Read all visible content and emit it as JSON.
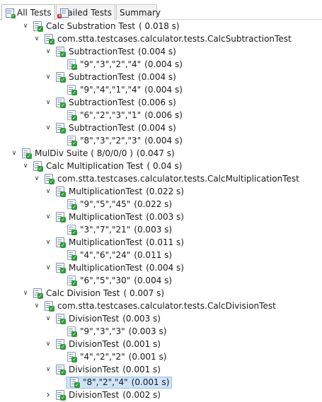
{
  "tabs": [
    {
      "label": "All Tests",
      "active": true
    },
    {
      "label": "Failed Tests",
      "active": false
    },
    {
      "label": "Summary",
      "active": false
    }
  ],
  "tree": [
    {
      "depth": 1,
      "arrow": "v",
      "label": "Calc Substration Test",
      "time": "( 0.018 s)"
    },
    {
      "depth": 2,
      "arrow": "v",
      "label": "com.stta.testcases.calculator.tests.CalcSubtractionTest",
      "time": ""
    },
    {
      "depth": 3,
      "arrow": "v",
      "label": "SubtractionTest",
      "time": "(0.004 s)"
    },
    {
      "depth": 4,
      "arrow": "",
      "label": "\"9\",\"3\",\"2\",\"4\"",
      "time": "(0.004 s)"
    },
    {
      "depth": 3,
      "arrow": "v",
      "label": "SubtractionTest",
      "time": "(0.004 s)"
    },
    {
      "depth": 4,
      "arrow": "",
      "label": "\"9\",\"4\",\"1\",\"4\"",
      "time": "(0.004 s)"
    },
    {
      "depth": 3,
      "arrow": "v",
      "label": "SubtractionTest",
      "time": "(0.006 s)"
    },
    {
      "depth": 4,
      "arrow": "",
      "label": "\"6\",\"2\",\"3\",\"1\"",
      "time": "(0.006 s)"
    },
    {
      "depth": 3,
      "arrow": "v",
      "label": "SubtractionTest",
      "time": "(0.004 s)"
    },
    {
      "depth": 4,
      "arrow": "",
      "label": "\"8\",\"3\",\"2\",\"3\"",
      "time": "(0.004 s)"
    },
    {
      "depth": 0,
      "arrow": "v",
      "label": "MulDiv Suite ( 8/0/0/0 )",
      "time": "(0.047 s)"
    },
    {
      "depth": 1,
      "arrow": "v",
      "label": "Calc Multiplication Test",
      "time": "( 0.04 s)"
    },
    {
      "depth": 2,
      "arrow": "v",
      "label": "com.stta.testcases.calculator.tests.CalcMultiplicationTest",
      "time": ""
    },
    {
      "depth": 3,
      "arrow": "v",
      "label": "MultiplicationTest",
      "time": "(0.022 s)"
    },
    {
      "depth": 4,
      "arrow": "",
      "label": "\"9\",\"5\",\"45\"",
      "time": "(0.022 s)"
    },
    {
      "depth": 3,
      "arrow": "v",
      "label": "MultiplicationTest",
      "time": "(0.003 s)"
    },
    {
      "depth": 4,
      "arrow": "",
      "label": "\"3\",\"7\",\"21\"",
      "time": "(0.003 s)"
    },
    {
      "depth": 3,
      "arrow": "v",
      "label": "MultiplicationTest",
      "time": "(0.011 s)"
    },
    {
      "depth": 4,
      "arrow": "",
      "label": "\"4\",\"6\",\"24\"",
      "time": "(0.011 s)"
    },
    {
      "depth": 3,
      "arrow": "v",
      "label": "MultiplicationTest",
      "time": "(0.004 s)"
    },
    {
      "depth": 4,
      "arrow": "",
      "label": "\"6\",\"5\",\"30\"",
      "time": "(0.004 s)"
    },
    {
      "depth": 1,
      "arrow": "v",
      "label": "Calc Division Test",
      "time": "( 0.007 s)"
    },
    {
      "depth": 2,
      "arrow": "v",
      "label": "com.stta.testcases.calculator.tests.CalcDivisionTest",
      "time": ""
    },
    {
      "depth": 3,
      "arrow": "v",
      "label": "DivisionTest",
      "time": "(0.003 s)"
    },
    {
      "depth": 4,
      "arrow": "",
      "label": "\"9\",\"3\",\"3\"",
      "time": "(0.003 s)"
    },
    {
      "depth": 3,
      "arrow": "v",
      "label": "DivisionTest",
      "time": "(0.001 s)"
    },
    {
      "depth": 4,
      "arrow": "",
      "label": "\"4\",\"2\",\"2\"",
      "time": "(0.001 s)"
    },
    {
      "depth": 3,
      "arrow": "v",
      "label": "DivisionTest",
      "time": "(0.001 s)"
    },
    {
      "depth": 4,
      "arrow": "",
      "label": "\"8\",\"2\",\"4\"",
      "time": "(0.001 s)",
      "selected": true
    },
    {
      "depth": 3,
      "arrow": ">",
      "label": "DivisionTest",
      "time": "(0.002 s)"
    }
  ],
  "colors": {
    "pass": "#2e9a3c",
    "selection": "#cfe2f7"
  },
  "icons": {
    "tab_icon": "test-results-icon",
    "node_icon": "test-suite-passed-icon",
    "leaf_icon": "test-case-passed-icon",
    "expand_icon": "chevron-down-icon"
  }
}
